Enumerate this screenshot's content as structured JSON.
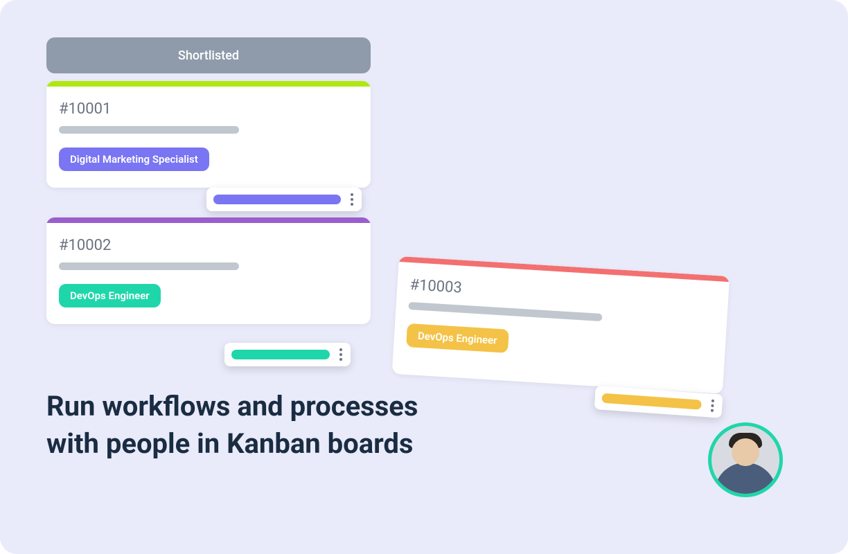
{
  "column": {
    "header": "Shortlisted"
  },
  "cards": [
    {
      "id": "#10001",
      "tag": "Digital Marketing Specialist",
      "stripe_color": "green",
      "tag_color": "indigo"
    },
    {
      "id": "#10002",
      "tag": "DevOps Engineer",
      "stripe_color": "purple",
      "tag_color": "teal"
    },
    {
      "id": "#10003",
      "tag": "DevOps Engineer",
      "stripe_color": "red",
      "tag_color": "amber"
    }
  ],
  "headline": "Run workflows and processes with people in Kanban boards",
  "colors": {
    "bg": "#e9eafa",
    "header": "#8f9bab",
    "stripe_green": "#b0e713",
    "stripe_purple": "#9a5ecc",
    "stripe_red": "#f37070",
    "indigo": "#7975f3",
    "teal": "#1fd6aa",
    "amber": "#f4c247"
  }
}
